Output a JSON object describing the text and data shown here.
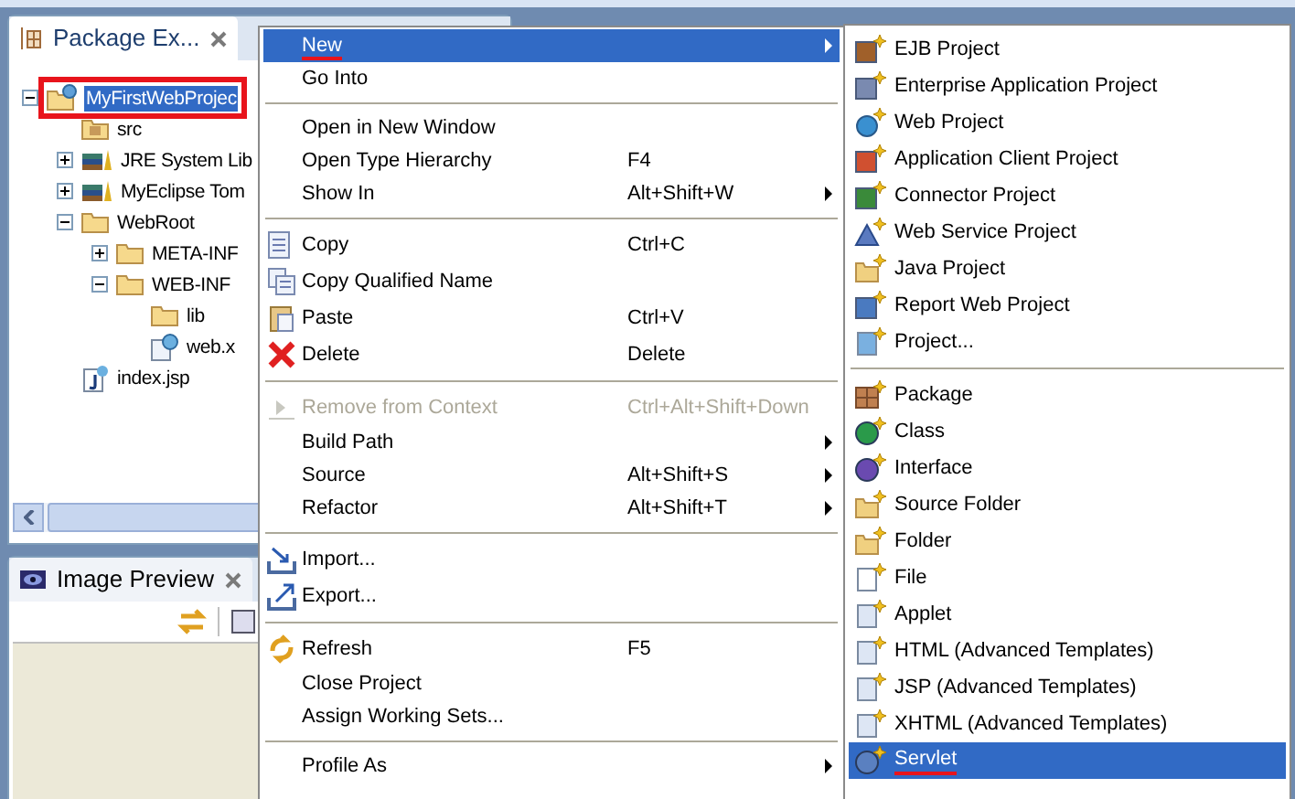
{
  "package_explorer": {
    "tab": {
      "label": "Package Ex...",
      "selected": true
    },
    "tree": [
      {
        "label": "MyFirstWebProjec",
        "kind": "project",
        "selected": true,
        "annotated": true,
        "expanded": true,
        "children": [
          {
            "label": "src",
            "kind": "source",
            "selected": false
          },
          {
            "label": "JRE System Lib",
            "kind": "library",
            "selected": false,
            "expanded": false
          },
          {
            "label": "MyEclipse Tom",
            "kind": "library",
            "selected": false,
            "expanded": false
          },
          {
            "label": "WebRoot",
            "kind": "folder",
            "selected": false,
            "expanded": true,
            "children": [
              {
                "label": "META-INF",
                "kind": "folder",
                "selected": false,
                "expanded": false
              },
              {
                "label": "WEB-INF",
                "kind": "folder",
                "selected": false,
                "expanded": true,
                "children": [
                  {
                    "label": "lib",
                    "kind": "folder",
                    "selected": false
                  },
                  {
                    "label": "web.x",
                    "kind": "xml",
                    "selected": false
                  }
                ]
              }
            ]
          },
          {
            "label": "index.jsp",
            "kind": "jsp",
            "selected": false
          }
        ]
      }
    ]
  },
  "image_preview": {
    "tab": {
      "label": "Image Preview",
      "selected": false
    }
  },
  "context_menu": [
    {
      "kind": "item",
      "label": "New",
      "submenu": true,
      "selected": true,
      "disabled": false,
      "underlined": true
    },
    {
      "kind": "item",
      "label": "Go Into",
      "submenu": false,
      "selected": false,
      "disabled": false,
      "underlined": false
    },
    {
      "kind": "separator"
    },
    {
      "kind": "item",
      "label": "Open in New Window",
      "submenu": false,
      "selected": false,
      "disabled": false,
      "underlined": false
    },
    {
      "kind": "item",
      "label": "Open Type Hierarchy",
      "shortcut": "F4",
      "submenu": false,
      "selected": false,
      "disabled": false,
      "underlined": false
    },
    {
      "kind": "item",
      "label": "Show In",
      "shortcut": "Alt+Shift+W",
      "submenu": true,
      "selected": false,
      "disabled": false,
      "underlined": false
    },
    {
      "kind": "separator"
    },
    {
      "kind": "item",
      "label": "Copy",
      "shortcut": "Ctrl+C",
      "submenu": false,
      "selected": false,
      "disabled": false,
      "underlined": false
    },
    {
      "kind": "item",
      "label": "Copy Qualified Name",
      "submenu": false,
      "selected": false,
      "disabled": false,
      "underlined": false
    },
    {
      "kind": "item",
      "label": "Paste",
      "shortcut": "Ctrl+V",
      "submenu": false,
      "selected": false,
      "disabled": false,
      "underlined": false
    },
    {
      "kind": "item",
      "label": "Delete",
      "shortcut": "Delete",
      "submenu": false,
      "selected": false,
      "disabled": false,
      "underlined": false
    },
    {
      "kind": "separator"
    },
    {
      "kind": "item",
      "label": "Remove from Context",
      "shortcut": "Ctrl+Alt+Shift+Down",
      "submenu": false,
      "selected": false,
      "disabled": true,
      "underlined": false
    },
    {
      "kind": "item",
      "label": "Build Path",
      "submenu": true,
      "selected": false,
      "disabled": false,
      "underlined": false
    },
    {
      "kind": "item",
      "label": "Source",
      "shortcut": "Alt+Shift+S",
      "submenu": true,
      "selected": false,
      "disabled": false,
      "underlined": false
    },
    {
      "kind": "item",
      "label": "Refactor",
      "shortcut": "Alt+Shift+T",
      "submenu": true,
      "selected": false,
      "disabled": false,
      "underlined": false
    },
    {
      "kind": "separator"
    },
    {
      "kind": "item",
      "label": "Import...",
      "submenu": false,
      "selected": false,
      "disabled": false,
      "underlined": false
    },
    {
      "kind": "item",
      "label": "Export...",
      "submenu": false,
      "selected": false,
      "disabled": false,
      "underlined": false
    },
    {
      "kind": "separator"
    },
    {
      "kind": "item",
      "label": "Refresh",
      "shortcut": "F5",
      "submenu": false,
      "selected": false,
      "disabled": false,
      "underlined": false
    },
    {
      "kind": "item",
      "label": "Close Project",
      "submenu": false,
      "selected": false,
      "disabled": false,
      "underlined": false
    },
    {
      "kind": "item",
      "label": "Assign Working Sets...",
      "submenu": false,
      "selected": false,
      "disabled": false,
      "underlined": false
    },
    {
      "kind": "separator"
    },
    {
      "kind": "item",
      "label": "Profile As",
      "submenu": true,
      "selected": false,
      "disabled": false,
      "underlined": false
    }
  ],
  "new_submenu": [
    {
      "kind": "item",
      "label": "EJB Project",
      "selected": false,
      "underlined": false
    },
    {
      "kind": "item",
      "label": "Enterprise Application Project",
      "selected": false,
      "underlined": false
    },
    {
      "kind": "item",
      "label": "Web Project",
      "selected": false,
      "underlined": false
    },
    {
      "kind": "item",
      "label": "Application Client Project",
      "selected": false,
      "underlined": false
    },
    {
      "kind": "item",
      "label": "Connector Project",
      "selected": false,
      "underlined": false
    },
    {
      "kind": "item",
      "label": "Web Service Project",
      "selected": false,
      "underlined": false
    },
    {
      "kind": "item",
      "label": "Java Project",
      "selected": false,
      "underlined": false
    },
    {
      "kind": "item",
      "label": "Report Web Project",
      "selected": false,
      "underlined": false
    },
    {
      "kind": "item",
      "label": "Project...",
      "selected": false,
      "underlined": false
    },
    {
      "kind": "separator"
    },
    {
      "kind": "item",
      "label": "Package",
      "selected": false,
      "underlined": false
    },
    {
      "kind": "item",
      "label": "Class",
      "selected": false,
      "underlined": false
    },
    {
      "kind": "item",
      "label": "Interface",
      "selected": false,
      "underlined": false
    },
    {
      "kind": "item",
      "label": "Source Folder",
      "selected": false,
      "underlined": false
    },
    {
      "kind": "item",
      "label": "Folder",
      "selected": false,
      "underlined": false
    },
    {
      "kind": "item",
      "label": "File",
      "selected": false,
      "underlined": false
    },
    {
      "kind": "item",
      "label": "Applet",
      "selected": false,
      "underlined": false
    },
    {
      "kind": "item",
      "label": "HTML (Advanced Templates)",
      "selected": false,
      "underlined": false
    },
    {
      "kind": "item",
      "label": "JSP (Advanced Templates)",
      "selected": false,
      "underlined": false
    },
    {
      "kind": "item",
      "label": "XHTML (Advanced Templates)",
      "selected": false,
      "underlined": false
    },
    {
      "kind": "item",
      "label": "Servlet",
      "selected": true,
      "underlined": true
    }
  ]
}
